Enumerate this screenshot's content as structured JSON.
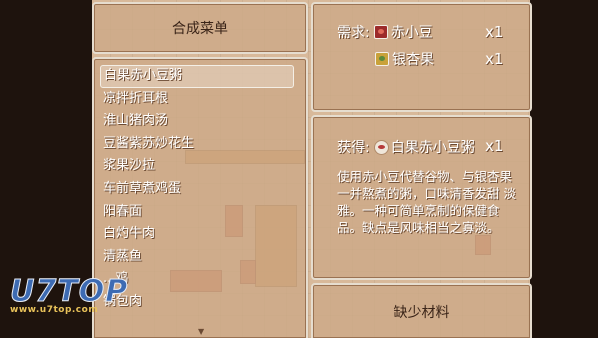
{
  "craft_menu": {
    "title": "合成菜单"
  },
  "recipes": [
    "白果赤小豆粥",
    "凉拌折耳根",
    "淮山猪肉汤",
    "豆酱紫苏炒花生",
    "浆果沙拉",
    "车前草煮鸡蛋",
    "阳春面",
    "白灼牛肉",
    "清蒸鱼",
    "...鸡",
    "锅包肉"
  ],
  "selected_recipe": "白果赤小豆粥",
  "requirements": {
    "label": "需求:",
    "items": [
      {
        "name": "赤小豆",
        "qty": "x1",
        "icon": "red-bean-icon"
      },
      {
        "name": "银杏果",
        "qty": "x1",
        "icon": "ginkgo-icon"
      }
    ]
  },
  "result": {
    "label": "获得:",
    "name": "白果赤小豆粥",
    "qty": "x1",
    "icon": "congee-bowl-icon",
    "description": "使用赤小豆代替谷物、与银杏果一并熬煮的粥，口味清香发甜 淡雅。一种可简单烹制的保健食品。缺点是风味相当之寡淡。"
  },
  "action": {
    "label": "缺少材料"
  },
  "watermark": {
    "logo": "U7TOP",
    "url": "www.u7top.com"
  },
  "colors": {
    "panel": "#cdaa87",
    "panel_border": "#e6ddcf",
    "text_light": "#ffffff",
    "text_dark": "#3a2418",
    "watermark": "#3d6bb3"
  }
}
